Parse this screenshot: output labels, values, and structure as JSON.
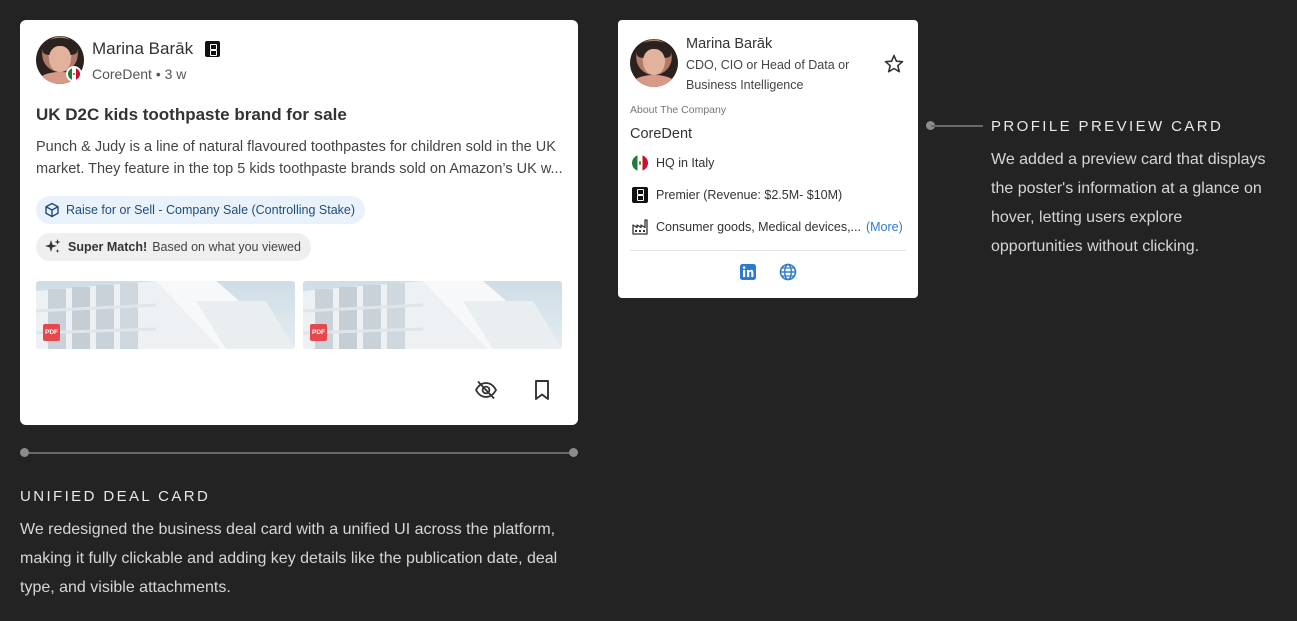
{
  "deal_card": {
    "author_name": "Marina Barāk",
    "company": "CoreDent",
    "age": "3 w",
    "title": "UK D2C kids toothpaste brand for sale",
    "description": "Punch & Judy is a line of natural flavoured toothpastes for children sold in the UK market. They feature in the top 5 kids toothpaste brands sold on Amazon’s UK w...",
    "deal_type": "Raise for or Sell - Company Sale (Controlling Stake)",
    "match_label": "Super Match!",
    "match_reason": "Based on what you viewed",
    "attachments": [
      {
        "type": "PDF"
      },
      {
        "type": "PDF"
      }
    ],
    "icons": [
      "tier-icon",
      "flag-mexico-icon",
      "cube-icon",
      "sparkle-icon",
      "pdf-icon",
      "eye-off-icon",
      "bookmark-icon"
    ]
  },
  "unified_annotation": {
    "title": "UNIFIED DEAL CARD",
    "text": "We redesigned the business deal card with a unified UI across the platform, making it fully clickable and adding key details like the publication date, deal type, and visible attachments."
  },
  "profile_card": {
    "name": "Marina Barāk",
    "role": "CDO, CIO or Head of Data or Business Intelligence",
    "about_label": "About The Company",
    "company": "CoreDent",
    "hq": "HQ in Italy",
    "tier": "Premier (Revenue: $2.5M- $10M)",
    "industries": "Consumer goods, Medical devices,...",
    "more_label": "(More)",
    "icons": [
      "star-icon",
      "flag-mexico-icon",
      "tier-icon",
      "factory-icon",
      "linkedin-icon",
      "globe-icon"
    ]
  },
  "profile_annotation": {
    "title": "PROFILE PREVIEW CARD",
    "text": "We added a preview card that displays the poster's information at a glance on hover, letting users explore opportunities without clicking."
  },
  "colors": {
    "background": "#232323",
    "card": "#ffffff",
    "chip_blue_bg": "#e9f1fa",
    "chip_blue_text": "#1f4e7a",
    "link": "#2c7bd0",
    "pdf_red": "#e5484d"
  }
}
